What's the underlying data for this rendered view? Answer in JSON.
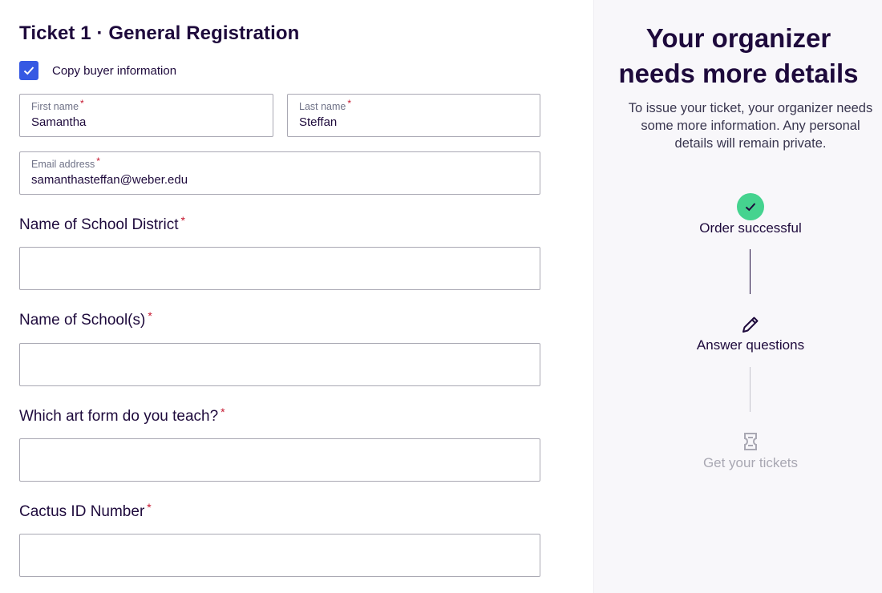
{
  "form": {
    "ticket_title": "Ticket 1 · General Registration",
    "copy_buyer": {
      "label": "Copy buyer information",
      "checked": true
    },
    "first_name": {
      "label": "First name",
      "required_mark": "*",
      "value": "Samantha"
    },
    "last_name": {
      "label": "Last name",
      "required_mark": "*",
      "value": "Steffan"
    },
    "email": {
      "label": "Email address",
      "required_mark": "*",
      "value": "samanthasteffan@weber.edu"
    },
    "questions": [
      {
        "label": "Name of School District",
        "required_mark": "*",
        "value": ""
      },
      {
        "label": "Name of School(s)",
        "required_mark": "*",
        "value": ""
      },
      {
        "label": "Which art form do you teach?",
        "required_mark": "*",
        "value": ""
      },
      {
        "label": "Cactus ID Number",
        "required_mark": "*",
        "value": ""
      }
    ]
  },
  "sidebar": {
    "title_line1": "Your organizer",
    "title_line2": "needs more details",
    "description": "To issue your ticket, your organizer needs some more information. Any personal details will remain private.",
    "steps": [
      {
        "label": "Order successful",
        "icon": "check-circle-icon",
        "status": "complete"
      },
      {
        "label": "Answer questions",
        "icon": "pencil-icon",
        "status": "current"
      },
      {
        "label": "Get your tickets",
        "icon": "ticket-icon",
        "status": "upcoming"
      }
    ]
  },
  "colors": {
    "accent_blue": "#3659e3",
    "success_green": "#45d38f",
    "required_red": "#c5162e",
    "sidebar_bg": "#f8f7fa",
    "muted_text": "#a9a8b3"
  }
}
